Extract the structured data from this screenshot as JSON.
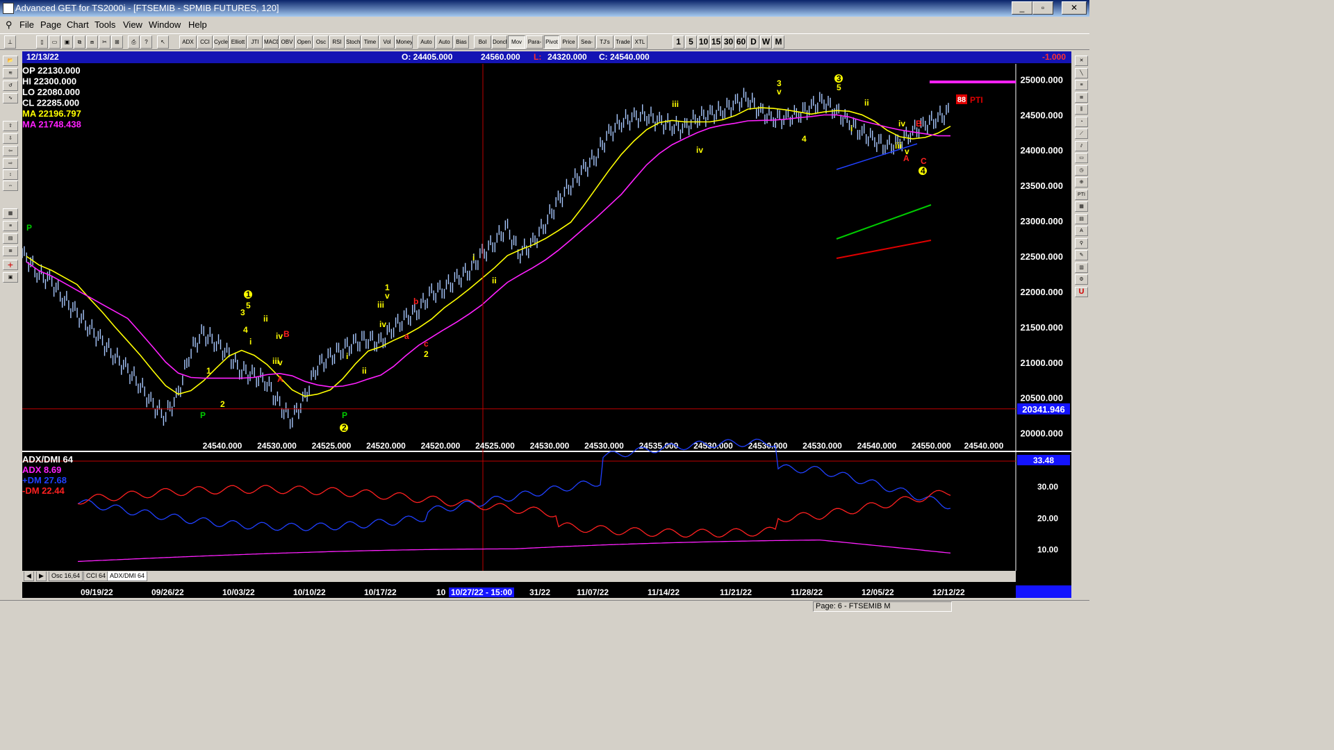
{
  "window": {
    "title": "Advanced GET for TS2000i - [FTSEMIB - SPMIB FUTURES, 120]"
  },
  "menu": [
    "File",
    "Page",
    "Chart",
    "Tools",
    "View",
    "Window",
    "Help"
  ],
  "toolbar": {
    "studies": [
      "ADX DMI",
      "CCI",
      "Cycles",
      "Elliott Trig",
      "JTI",
      "MACD",
      "OBV",
      "Open Int",
      "Osc",
      "RSI",
      "Stoch",
      "Time Clust",
      "Vol",
      "Money Flow",
      "Auto Gann",
      "Auto Trend",
      "Bias",
      "Bol Band",
      "Donch",
      "Mov Ave",
      "Para-bolic",
      "Pivot",
      "Price Clust",
      "Sea-sonals",
      "TJ's Web",
      "Trade Profile",
      "XTL"
    ],
    "intervals": [
      "1",
      "5",
      "10",
      "15",
      "30",
      "60",
      "D",
      "W",
      "M"
    ]
  },
  "left_tools": [
    "open",
    "elliott",
    "reset",
    "study",
    "up",
    "down",
    "left",
    "right",
    "expand",
    "compress",
    "grid",
    "lines",
    "gann",
    "fib",
    "plus",
    "print"
  ],
  "right_tools": [
    "x",
    "line",
    "fib ret",
    "fib ext",
    "fib time",
    "arc",
    "fan",
    "channel",
    "box",
    "clock",
    "epts",
    "PTI",
    "table",
    "MOB",
    "A",
    "zoom",
    "pen",
    "cal",
    "tools",
    "U"
  ],
  "info_bar": {
    "date": "12/13/22",
    "open": "O: 24405.000",
    "high": "24560.000",
    "low_label": "L:",
    "low": "24320.000",
    "close": "C: 24540.000",
    "change": "-1.000"
  },
  "legend": {
    "op": "OP  22130.000",
    "hi": "HI   22300.000",
    "lo": "LO  22080.000",
    "cl": "CL  22285.000",
    "ma1": "MA  22196.797",
    "ma2": "MA  21748.438"
  },
  "price_axis": [
    "25000.000",
    "24500.000",
    "24000.000",
    "23500.000",
    "23000.000",
    "22500.000",
    "22000.000",
    "21500.000",
    "21000.000",
    "20500.000",
    "20000.000"
  ],
  "price_cursor": "20341.946",
  "bottom_values": [
    "24540.000",
    "24530.000",
    "24525.000",
    "24520.000",
    "24520.000",
    "24525.000",
    "24530.000",
    "24530.000",
    "24535.000",
    "24530.000",
    "24530.000",
    "24530.000",
    "24540.000",
    "24550.000"
  ],
  "bottom_last": "24540.000",
  "pti": {
    "value": "88",
    "label": "PTI"
  },
  "wave_labels": [
    {
      "t": "P",
      "c": "#00cc00"
    },
    {
      "t": "1",
      "c": "#ffff00"
    },
    {
      "t": "2",
      "c": "#ffff00"
    },
    {
      "t": "P",
      "c": "#00cc00"
    },
    {
      "t": "1",
      "c": "#ffff00"
    },
    {
      "t": "5",
      "c": "#ffff00"
    },
    {
      "t": "3",
      "c": "#ffff00"
    },
    {
      "t": "4",
      "c": "#ffff00"
    },
    {
      "t": "i",
      "c": "#ffff00"
    },
    {
      "t": "ii",
      "c": "#ffff00"
    },
    {
      "t": "iv",
      "c": "#ffff00"
    },
    {
      "t": "B",
      "c": "#ff2020"
    },
    {
      "t": "iii",
      "c": "#ffff00"
    },
    {
      "t": "v",
      "c": "#ffff00"
    },
    {
      "t": "A",
      "c": "#ff2020"
    },
    {
      "t": "P",
      "c": "#00cc00"
    },
    {
      "t": "2",
      "c": "#ffff00"
    },
    {
      "t": "i",
      "c": "#ffff00"
    },
    {
      "t": "ii",
      "c": "#ffff00"
    },
    {
      "t": "1",
      "c": "#ffff00"
    },
    {
      "t": "v",
      "c": "#ffff00"
    },
    {
      "t": "iii",
      "c": "#ffff00"
    },
    {
      "t": "iv",
      "c": "#ffff00"
    },
    {
      "t": "b",
      "c": "#ff2020"
    },
    {
      "t": "a",
      "c": "#ff2020"
    },
    {
      "t": "c",
      "c": "#ff2020"
    },
    {
      "t": "2",
      "c": "#ffff00"
    },
    {
      "t": "i",
      "c": "#ffff00"
    },
    {
      "t": "ii",
      "c": "#ffff00"
    },
    {
      "t": "iii",
      "c": "#ffff00"
    },
    {
      "t": "iv",
      "c": "#ffff00"
    },
    {
      "t": "3",
      "c": "#ffff00"
    },
    {
      "t": "v",
      "c": "#ffff00"
    },
    {
      "t": "4",
      "c": "#ffff00"
    },
    {
      "t": "3",
      "c": "#ffff00"
    },
    {
      "t": "5",
      "c": "#ffff00"
    },
    {
      "t": "i",
      "c": "#ffff00"
    },
    {
      "t": "ii",
      "c": "#ffff00"
    },
    {
      "t": "iv",
      "c": "#ffff00"
    },
    {
      "t": "B",
      "c": "#ff2020"
    },
    {
      "t": "iii",
      "c": "#ffff00"
    },
    {
      "t": "v",
      "c": "#ffff00"
    },
    {
      "t": "A",
      "c": "#ff2020"
    },
    {
      "t": "C",
      "c": "#ff2020"
    },
    {
      "t": "4",
      "c": "#ffff00"
    }
  ],
  "indicator": {
    "title": "ADX/DMI 64",
    "adx": "ADX 8.69",
    "pdm": "+DM 27.68",
    "mdm": "-DM  22.44",
    "axis": [
      "30.00",
      "20.00",
      "10.00"
    ],
    "cursor": "33.48"
  },
  "tabs": [
    "Osc 16,64",
    "CCI 64",
    "ADX/DMI 64"
  ],
  "dates": [
    "09/19/22",
    "09/26/22",
    "10/03/22",
    "10/10/22",
    "10/17/22",
    "10",
    "10/27/22 - 15:00",
    "31/22",
    "11/07/22",
    "11/14/22",
    "11/21/22",
    "11/28/22",
    "12/05/22",
    "12/12/22"
  ],
  "status": {
    "page": "Page: 6 - FTSEMIB M"
  },
  "colors": {
    "bars": "#a8c8ff",
    "ma_fast": "#ffff00",
    "ma_slow": "#ff20ff",
    "cursor": "#c00000",
    "adx": "#ff20ff",
    "pdm": "#2040ff",
    "mdm": "#ff2020",
    "info_bg": "#1414b4"
  },
  "chart_data": {
    "type": "line",
    "title": "FTSEMIB - SPMIB FUTURES, 120",
    "series": [
      {
        "name": "price",
        "values": [
          22500,
          22250,
          22150,
          21900,
          21700,
          21500,
          21300,
          21100,
          20900,
          20700,
          20400,
          20250,
          20500,
          21150,
          21400,
          21300,
          21100,
          20900,
          20800,
          20750,
          20400,
          20200,
          20450,
          20950,
          21050,
          21200,
          21250,
          21350,
          21250,
          21500,
          21600,
          21750,
          21950,
          22050,
          22150,
          22300,
          22500,
          22700,
          22900,
          22550,
          22650,
          22950,
          23250,
          23500,
          23700,
          23900,
          24200,
          24400,
          24450,
          24500,
          24400,
          24350,
          24300,
          24450,
          24500,
          24550,
          24650,
          24750,
          24550,
          24450,
          24450,
          24500,
          24600,
          24700,
          24550,
          24400,
          24250,
          24150,
          24050,
          24100,
          24250,
          24350,
          24450,
          24540
        ]
      }
    ],
    "ylim": [
      19800,
      25200
    ]
  }
}
